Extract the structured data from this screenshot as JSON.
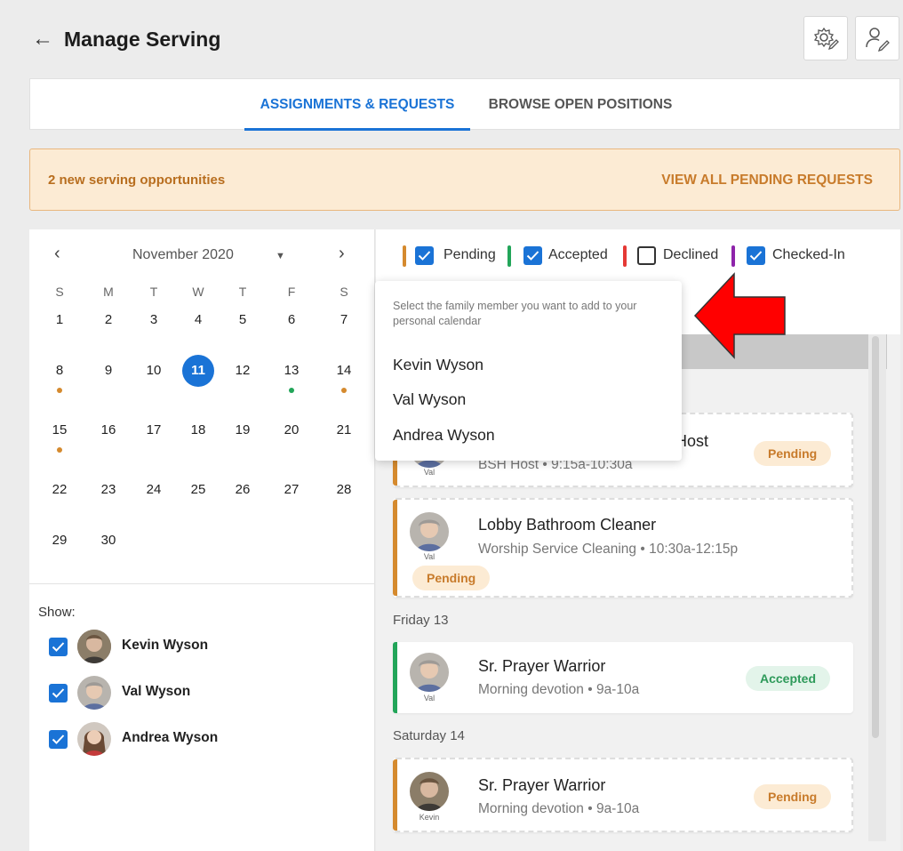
{
  "header": {
    "back_icon": "arrow-left-icon",
    "title": "Manage Serving",
    "settings_icon": "gear-pencil-icon",
    "profile_icon": "user-pencil-icon"
  },
  "tabs": [
    {
      "label": "ASSIGNMENTS & REQUESTS",
      "active": true
    },
    {
      "label": "BROWSE OPEN POSITIONS",
      "active": false
    }
  ],
  "banner": {
    "text": "2 new serving opportunities",
    "link": "VIEW ALL PENDING REQUESTS"
  },
  "calendar": {
    "prev_icon": "chevron-left-icon",
    "next_icon": "chevron-right-icon",
    "month": "November 2020",
    "caret_icon": "caret-down-icon",
    "weekdays": [
      "S",
      "M",
      "T",
      "W",
      "T",
      "F",
      "S"
    ],
    "weeks": [
      [
        "1",
        "2",
        "3",
        "4",
        "5",
        "6",
        "7"
      ],
      [
        "8",
        "9",
        "10",
        "11",
        "12",
        "13",
        "14"
      ],
      [
        "15",
        "16",
        "17",
        "18",
        "19",
        "20",
        "21"
      ],
      [
        "22",
        "23",
        "24",
        "25",
        "26",
        "27",
        "28"
      ],
      [
        "29",
        "30"
      ]
    ],
    "today": "11"
  },
  "show": {
    "label": "Show:",
    "members": [
      "Kevin Wyson",
      "Val Wyson",
      "Andrea Wyson"
    ]
  },
  "legend": [
    {
      "label": "Pending",
      "color": "#d58a2e",
      "checked": true
    },
    {
      "label": "Accepted",
      "color": "#22a559",
      "checked": true
    },
    {
      "label": "Declined",
      "color": "#e53935",
      "checked": false
    },
    {
      "label": "Checked-In",
      "color": "#8e24aa",
      "checked": true
    }
  ],
  "popup": {
    "hint": "Select the family member you want to add to your personal calendar",
    "items": [
      "Kevin Wyson",
      "Val Wyson",
      "Andrea Wyson"
    ]
  },
  "schedule": {
    "card1": {
      "title": "Host",
      "sub": "BSH Host • 9:15a-10:30a",
      "avatar_label": "Val",
      "status": "Pending"
    },
    "card2": {
      "title": "Lobby Bathroom Cleaner",
      "sub": "Worship Service Cleaning • 10:30a-12:15p",
      "avatar_label": "Val",
      "status": "Pending"
    },
    "date_fri": "Friday 13",
    "card3": {
      "title": "Sr. Prayer Warrior",
      "sub": "Morning devotion • 9a-10a",
      "avatar_label": "Val",
      "status": "Accepted"
    },
    "date_sat": "Saturday 14",
    "card4": {
      "title": "Sr. Prayer Warrior",
      "sub": "Morning devotion • 9a-10a",
      "avatar_label": "Kevin",
      "status": "Pending"
    }
  },
  "colors": {
    "accent": "#1a73d6",
    "pending": "#d58a2e",
    "accepted": "#22a559",
    "arrow": "#ff0000"
  }
}
